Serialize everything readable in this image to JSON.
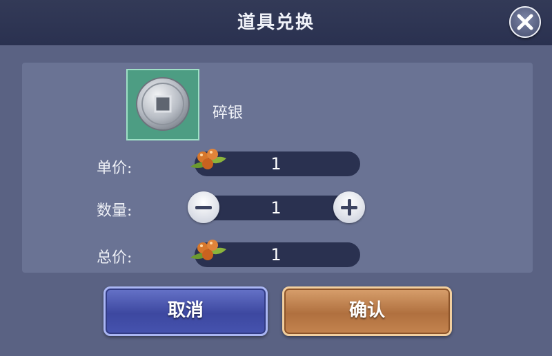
{
  "dialog": {
    "title": "道具兑换",
    "close_icon": "close-x-icon"
  },
  "item": {
    "icon": "silver-coin-icon",
    "name": "碎银"
  },
  "unit_price": {
    "label": "单价:",
    "currency_icon": "berry-currency-icon",
    "value": "1"
  },
  "quantity": {
    "label": "数量:",
    "decrease_icon": "minus-icon",
    "increase_icon": "plus-icon",
    "value": "1"
  },
  "total_price": {
    "label": "总价:",
    "currency_icon": "berry-currency-icon",
    "value": "1"
  },
  "actions": {
    "cancel_label": "取消",
    "confirm_label": "确认"
  },
  "colors": {
    "background": "#5a6283",
    "header": "#2a3150",
    "cancel": "#4653af",
    "confirm": "#c4844f",
    "item_frame": "#4d9d83"
  }
}
